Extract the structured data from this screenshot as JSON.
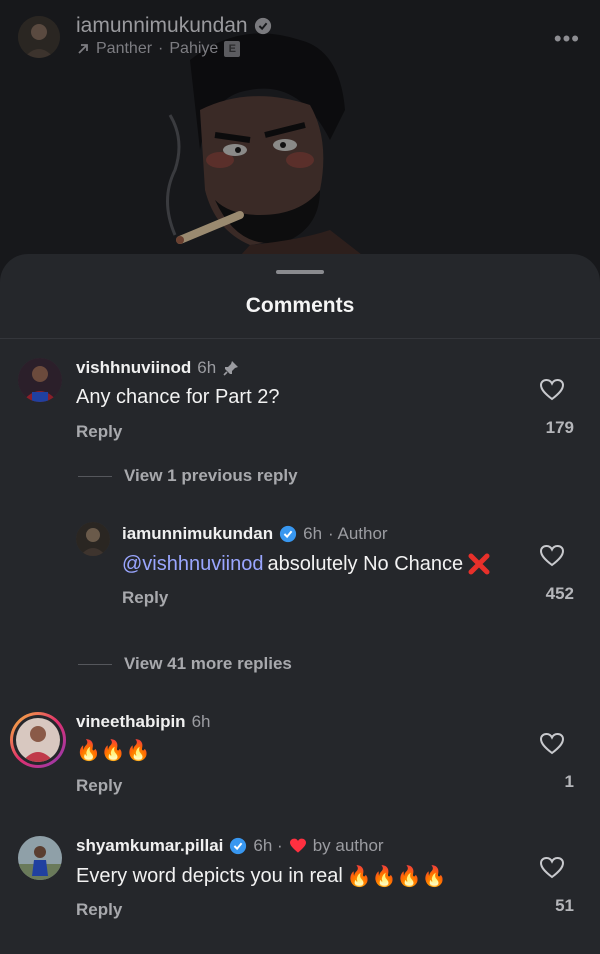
{
  "post": {
    "username": "iamunnimukundan",
    "music_artist": "Panther",
    "music_title": "Pahiye",
    "explicit_badge": "E",
    "more_icon": "more-horizontal-icon"
  },
  "sheet": {
    "title": "Comments"
  },
  "comments": [
    {
      "username": "vishhnuviinod",
      "time": "6h",
      "text": "Any chance for Part 2?",
      "reply_label": "Reply",
      "likes": "179",
      "pinned": true
    },
    {
      "username": "iamunnimukundan",
      "time": "6h",
      "author_tag": "· Author",
      "mention": "@vishhnuviinod",
      "text": "absolutely No Chance",
      "reply_label": "Reply",
      "likes": "452",
      "verified": true
    },
    {
      "username": "vineethabipin",
      "time": "6h",
      "text": "🔥🔥🔥",
      "reply_label": "Reply",
      "likes": "1"
    },
    {
      "username": "shyamkumar.pillai",
      "time": "6h ·",
      "liked_by": "by author",
      "text": "Every word depicts you in real",
      "reply_label": "Reply",
      "likes": "51",
      "verified": true
    }
  ],
  "view_replies": [
    {
      "label": "View 1 previous reply"
    },
    {
      "label": "View 41 more replies"
    }
  ],
  "colors": {
    "sheet_bg": "#25272b",
    "mention": "#9aa6ff",
    "verified": "#3897f0",
    "heart_red": "#ff3040"
  }
}
